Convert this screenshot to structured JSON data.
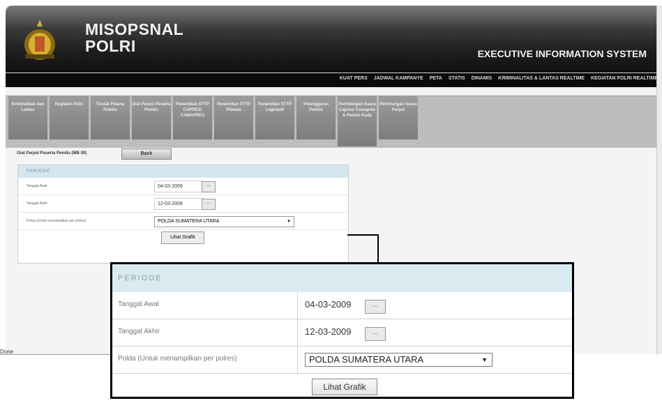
{
  "app": {
    "brand_line1": "MISOPSNAL",
    "brand_line2": "POLRI",
    "system_title": "EXECUTIVE INFORMATION SYSTEM"
  },
  "topnav": [
    "KUAT PERS",
    "JADWAL KAMPANYE",
    "PETA",
    "STATIS",
    "DINAMIS",
    "KRIMINALITAS & LANTAS REALTIME",
    "KEGIATAN POLRI REALTIME"
  ],
  "tabs": [
    "Kriminalitas dan Lantas",
    "Kegiatan Polri",
    "Tindak Pidana Pemilu",
    "Giat Parpol Peserta Pemilu",
    "Penerbitan STTP CAPRES/ CAWAPRES",
    "Penerbitan STTP Pilkada",
    "Penerbitan STTP Legislatif",
    "Pelanggaran Pemilu",
    "Perhitungan Suara Capres/ Cawapres & Pemilu Kada",
    "Perhitungan Suara Parpol"
  ],
  "page": {
    "header": "Giat Parpol Peserta Pemilu (MB-30)",
    "back_label": "Back"
  },
  "form": {
    "section_title": "PERIODE",
    "start_label": "Tanggal Awal",
    "start_value": "04-03-2009",
    "end_label": "Tanggal Akhir",
    "end_value": "12-03-2009",
    "polda_label": "Polda (Untuk menampilkan per polres)",
    "polda_value": "POLDA SUMATERA UTARA",
    "picker_label": "...",
    "submit_label": "Lihat Grafik"
  },
  "status": {
    "text": "Done"
  }
}
